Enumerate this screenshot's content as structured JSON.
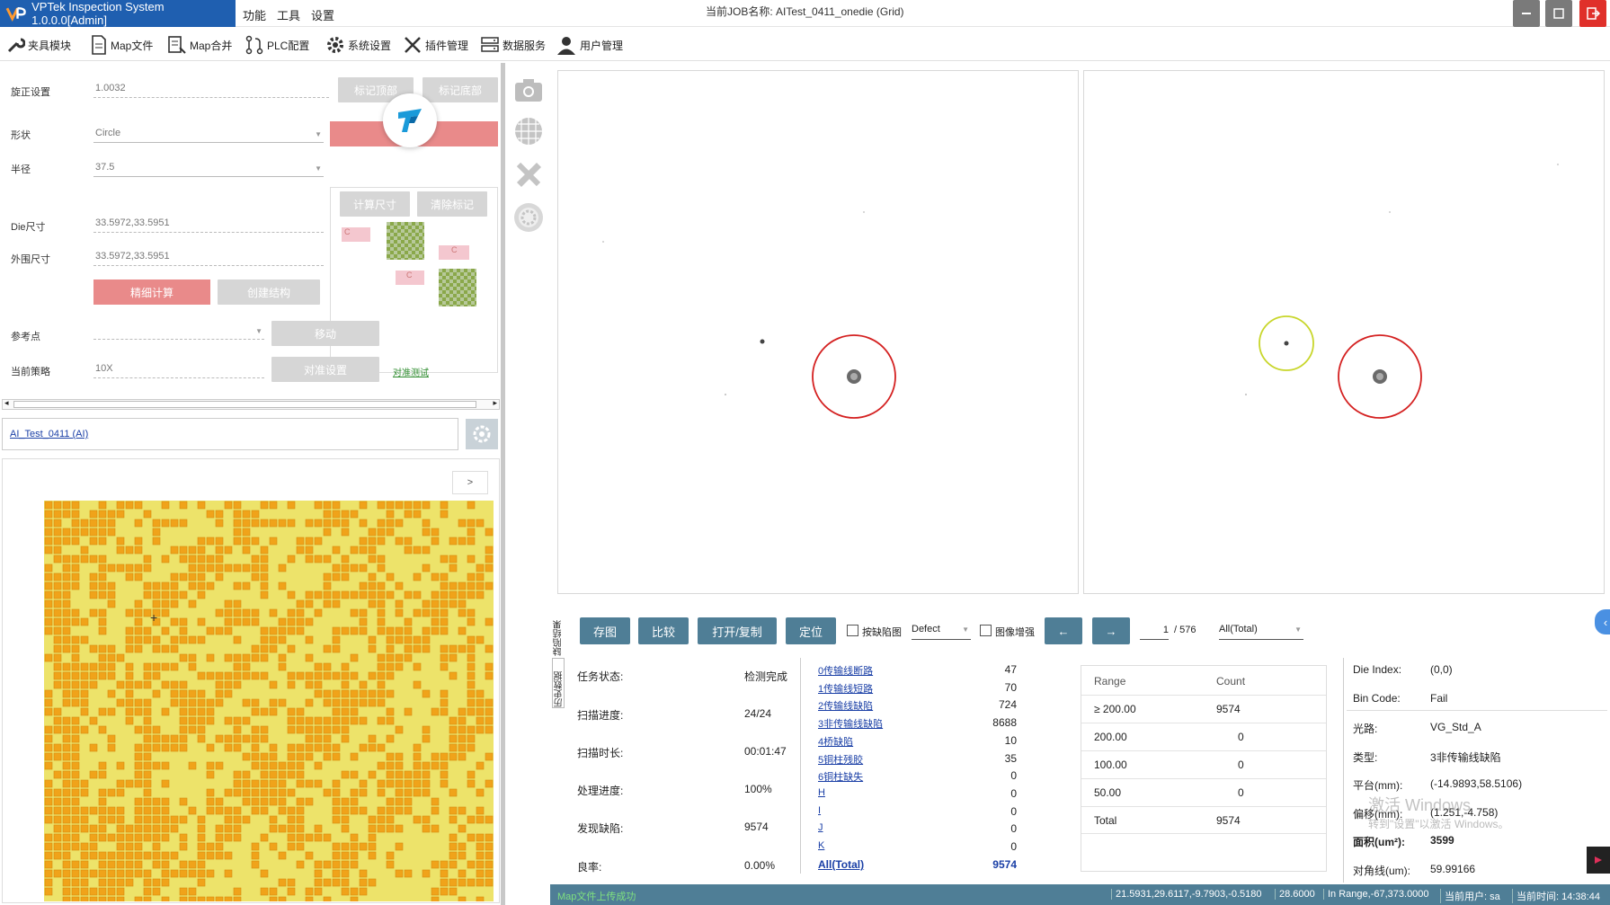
{
  "window": {
    "title": "VPTek Inspection System 1.0.0.0[Admin]",
    "menu": [
      "功能",
      "工具",
      "设置"
    ],
    "job_name": "当前JOB名称: AITest_0411_onedie (Grid)"
  },
  "toolbar": {
    "items": [
      {
        "label": "夹具模块",
        "icon": "wrench-icon"
      },
      {
        "label": "Map文件",
        "icon": "document-icon"
      },
      {
        "label": "Map合并",
        "icon": "merge-icon"
      },
      {
        "label": "PLC配置",
        "icon": "branch-icon"
      },
      {
        "label": "系统设置",
        "icon": "gear-icon"
      },
      {
        "label": "插件管理",
        "icon": "tools-icon"
      },
      {
        "label": "数据服务",
        "icon": "server-icon"
      },
      {
        "label": "用户管理",
        "icon": "user-icon"
      }
    ]
  },
  "left": {
    "rotate_label": "旋正设置",
    "rotate_value": "1.0032",
    "shape_label": "形状",
    "shape_value": "Circle",
    "radius_label": "半径",
    "radius_value": "37.5",
    "die_size_label": "Die尺寸",
    "die_size_value": "33.5972,33.5951",
    "outer_size_label": "外围尺寸",
    "outer_size_value": "33.5972,33.5951",
    "mark_top_btn": "标记顶部",
    "mark_bottom_btn": "标记底部",
    "calc_size_btn": "计算尺寸",
    "clear_mark_btn": "清除标记",
    "fine_calc_btn": "精细计算",
    "create_struct_btn": "创建结构",
    "ref_point_label": "参考点",
    "ref_point_value": "",
    "move_btn": "移动",
    "strategy_label": "当前策略",
    "strategy_value": "10X",
    "align_btn": "对准设置",
    "align_test_link": "对准测试",
    "mark_c": "C",
    "job_link": "AI_Test_0411 (AI)",
    "expand_btn": ">"
  },
  "actions": {
    "save_image": "存图",
    "compare": "比较",
    "open_copy": "打开/复制",
    "locate": "定位",
    "by_defect_label": "按缺陷图",
    "defect_select": "Defect",
    "image_enhance_label": "图像增强",
    "prev": "←",
    "next": "→",
    "page_current": "1",
    "page_total": "/ 576",
    "filter_select": "All(Total)",
    "history_tab": "历史数据",
    "defect_result_tab": "缺陷结果"
  },
  "stats": [
    {
      "label": "任务状态:",
      "value": "检测完成"
    },
    {
      "label": "扫描进度:",
      "value": "24/24"
    },
    {
      "label": "扫描时长:",
      "value": "00:01:47"
    },
    {
      "label": "处理进度:",
      "value": "100%"
    },
    {
      "label": "发现缺陷:",
      "value": "9574"
    },
    {
      "label": "良率:",
      "value": "0.00%"
    }
  ],
  "defects": [
    {
      "name": "0传输线断路",
      "count": "47"
    },
    {
      "name": "1传输线短路",
      "count": "70"
    },
    {
      "name": "2传输线缺陷",
      "count": "724"
    },
    {
      "name": "3非传输线缺陷",
      "count": "8688"
    },
    {
      "name": "4桥缺陷",
      "count": "10"
    },
    {
      "name": "5铜柱残胶",
      "count": "35"
    },
    {
      "name": "6铜柱缺失",
      "count": "0"
    },
    {
      "name": "H",
      "count": "0"
    },
    {
      "name": "I",
      "count": "0"
    },
    {
      "name": "J",
      "count": "0"
    },
    {
      "name": "K",
      "count": "0"
    },
    {
      "name": "All(Total)",
      "count": "9574"
    }
  ],
  "range_table": {
    "headers": [
      "Range",
      "Count"
    ],
    "rows": [
      [
        "≥ 200.00",
        "9574"
      ],
      [
        "200.00",
        "0"
      ],
      [
        "100.00",
        "0"
      ],
      [
        "50.00",
        "0"
      ],
      [
        "Total",
        "9574"
      ]
    ]
  },
  "info": [
    {
      "label": "Die Index:",
      "value": "(0,0)"
    },
    {
      "label": "Bin Code:",
      "value": "Fail"
    },
    {
      "label": "光路:",
      "value": "VG_Std_A"
    },
    {
      "label": "类型:",
      "value": "3非传输线缺陷"
    },
    {
      "label": "平台(mm):",
      "value": "(-14.9893,58.5106)"
    },
    {
      "label": "偏移(mm):",
      "value": "(1.251,-4.758)"
    },
    {
      "label": "面积(um²):",
      "value": "3599"
    },
    {
      "label": "对角线(um):",
      "value": "59.99166"
    }
  ],
  "watermark": {
    "line1": "激活 Windows",
    "line2": "转到\"设置\"以激活 Windows。"
  },
  "status": {
    "message": "Map文件上传成功",
    "coords": "21.5931,29.6117,-9.7903,-0.5180",
    "value": "28.6000",
    "range": "In Range,-67,373.0000",
    "user": "当前用户: sa",
    "time": "当前时间: 14:38:44"
  },
  "colors": {
    "title_bg": "#1f5fb0",
    "accent": "#4f7e96",
    "close_red": "#e0302a",
    "pink": "#e98a8a",
    "wafer_orange": "#f0a31a",
    "wafer_yellow": "#ede36a",
    "defect_circle": "#d42020",
    "ref_circle": "#c8d62a"
  }
}
